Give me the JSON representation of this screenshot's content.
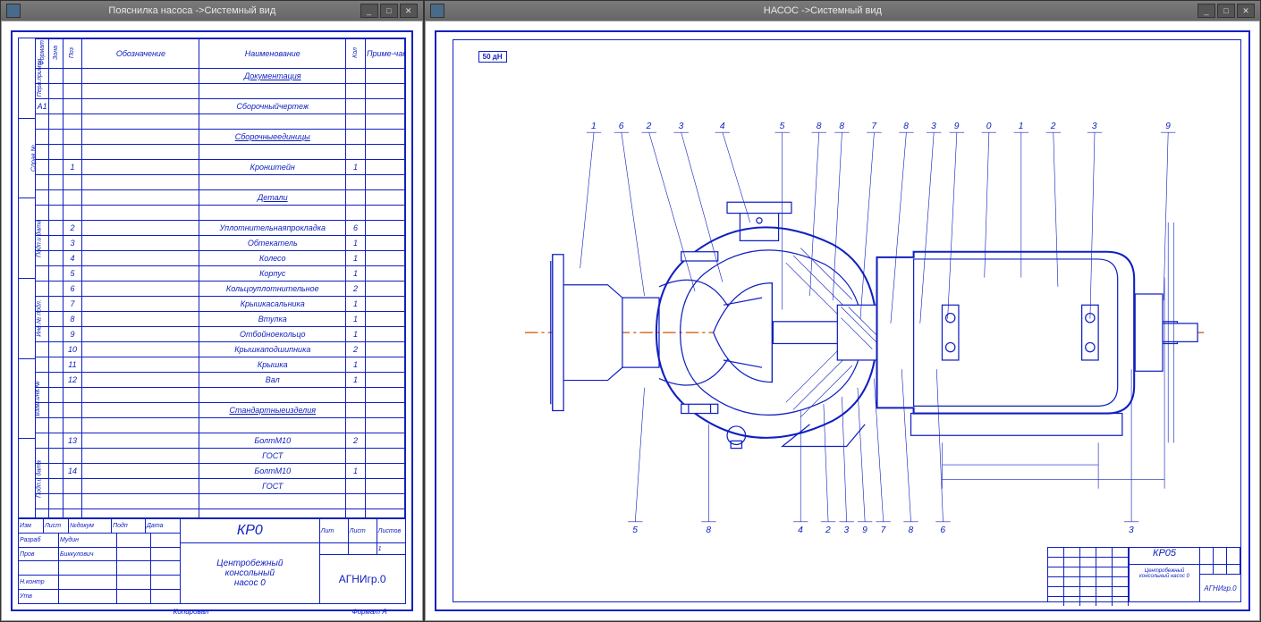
{
  "window1": {
    "title": "Пояснилка насоса ->Системный вид",
    "min": "_",
    "max": "□",
    "close": "✕"
  },
  "window2": {
    "title": "НАСОС ->Системный вид",
    "min": "_",
    "max": "□",
    "close": "✕",
    "section_label": "50 дН"
  },
  "leftmargin": [
    "Перв.примен",
    "Справ.№",
    "Подп.и дата",
    "Инв.№ подл.",
    "Взам.инв.№",
    "Подп.и дата"
  ],
  "spec": {
    "headers": {
      "format": "Формат",
      "zone": "Зона",
      "pos": "Поз",
      "des": "Обозначение",
      "name": "Наименование",
      "qty": "Кол",
      "note": "Приме-чание"
    },
    "sections": [
      {
        "title": "Документация",
        "rows": [
          {
            "format": "А1",
            "pos": "",
            "des": "",
            "name": "Сборочныйчертеж",
            "qty": "",
            "note": ""
          }
        ]
      },
      {
        "title": "Сборочныеединицы",
        "rows": [
          {
            "format": "",
            "pos": "1",
            "des": "",
            "name": "Кронштейн",
            "qty": "1",
            "note": ""
          }
        ]
      },
      {
        "title": "Детали",
        "rows": [
          {
            "format": "",
            "pos": "2",
            "des": "",
            "name": "Уплотнительнаяпрокладка",
            "qty": "6",
            "note": ""
          },
          {
            "format": "",
            "pos": "3",
            "des": "",
            "name": "Обтекатель",
            "qty": "1",
            "note": ""
          },
          {
            "format": "",
            "pos": "4",
            "des": "",
            "name": "Колесо",
            "qty": "1",
            "note": ""
          },
          {
            "format": "",
            "pos": "5",
            "des": "",
            "name": "Корпус",
            "qty": "1",
            "note": ""
          },
          {
            "format": "",
            "pos": "6",
            "des": "",
            "name": "Кольцоуплотнительное",
            "qty": "2",
            "note": ""
          },
          {
            "format": "",
            "pos": "7",
            "des": "",
            "name": "Крышкасальника",
            "qty": "1",
            "note": ""
          },
          {
            "format": "",
            "pos": "8",
            "des": "",
            "name": "Втулка",
            "qty": "1",
            "note": ""
          },
          {
            "format": "",
            "pos": "9",
            "des": "",
            "name": "Отбойноекольцо",
            "qty": "1",
            "note": ""
          },
          {
            "format": "",
            "pos": "10",
            "des": "",
            "name": "Крышкаподшипника",
            "qty": "2",
            "note": ""
          },
          {
            "format": "",
            "pos": "11",
            "des": "",
            "name": "Крышка",
            "qty": "1",
            "note": ""
          },
          {
            "format": "",
            "pos": "12",
            "des": "",
            "name": "Вал",
            "qty": "1",
            "note": ""
          }
        ]
      },
      {
        "title": "Стандартныеизделия",
        "rows": [
          {
            "format": "",
            "pos": "13",
            "des": "",
            "name": "БолтМ10",
            "qty": "2",
            "note": ""
          },
          {
            "format": "",
            "pos": "",
            "des": "",
            "name": "ГОСТ",
            "qty": "",
            "note": ""
          },
          {
            "format": "",
            "pos": "14",
            "des": "",
            "name": "БолтМ10",
            "qty": "1",
            "note": ""
          },
          {
            "format": "",
            "pos": "",
            "des": "",
            "name": "ГОСТ",
            "qty": "",
            "note": ""
          }
        ]
      }
    ]
  },
  "stamp": {
    "code": "КР0",
    "title1": "Центробежный",
    "title2": "консольный",
    "title3": "насос 0",
    "org": "АГНИгр.0",
    "lit": "Лит",
    "list": "Лист",
    "lists": "Листов",
    "n": "1",
    "left_rows": {
      "r1": {
        "a": "Изм",
        "b": "Лист",
        "c": "№докум",
        "d": "Подп",
        "e": "Дата"
      },
      "r2": {
        "a": "Разраб",
        "b": "Мудин"
      },
      "r3": {
        "a": "Пров",
        "b": "Биккулович"
      },
      "r4": {
        "a": "Н.контр",
        "b": ""
      },
      "r5": {
        "a": "Утв",
        "b": ""
      }
    },
    "footer": {
      "a": "Копировал",
      "b": "Формат",
      "c": "А"
    }
  },
  "mini_stamp": {
    "code": "КР05",
    "title": "Центробежный консольный насос 0",
    "org": "АГНИгр.0"
  },
  "callouts_top": [
    "1",
    "6",
    "2",
    "3",
    "4",
    "5",
    "8",
    "8",
    "7",
    "8",
    "3",
    "9",
    "0",
    "1",
    "2",
    "3",
    "9"
  ],
  "callouts_bot": [
    "5",
    "8",
    "4",
    "2",
    "3",
    "9",
    "7",
    "8",
    "6",
    "3"
  ]
}
